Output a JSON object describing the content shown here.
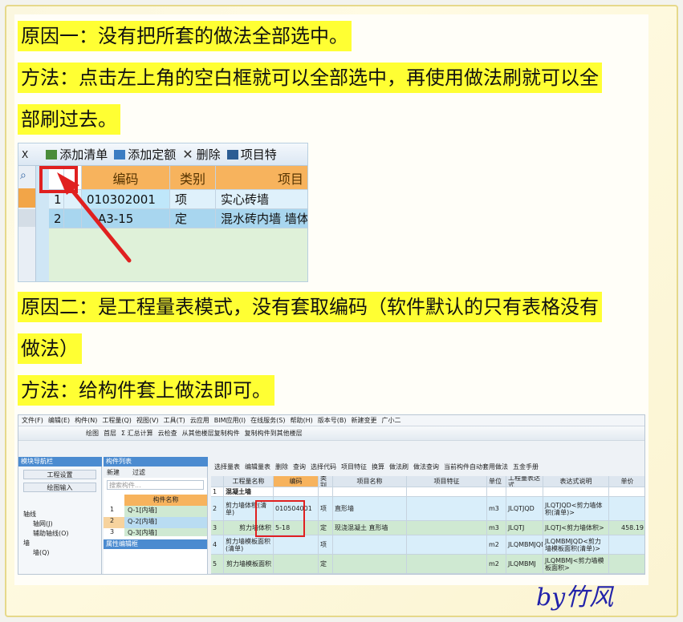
{
  "paragraphs": {
    "reason1": "原因一：没有把所套的做法全部选中。",
    "method1_line1": "方法：点击左上角的空白框就可以全部选中，再使用做法刷就可以全",
    "method1_line2": "部刷过去。",
    "reason2_line1": "原因二：是工程量表模式，没有套取编码（软件默认的只有表格没有",
    "reason2_line2": "做法）",
    "method2": "方法：给构件套上做法即可。"
  },
  "shot1": {
    "toolbar": {
      "close": "X",
      "add_list": "添加清单",
      "add_quota": "添加定额",
      "delete": "删除",
      "project": "项目特"
    },
    "headers": [
      "编码",
      "类别",
      "项目"
    ],
    "rows": [
      {
        "num": "1",
        "code": "010302001",
        "type": "项",
        "name": "实心砖墙"
      },
      {
        "num": "2",
        "code": "A3-15",
        "type": "定",
        "name": "混水砖内墙 墙体"
      }
    ]
  },
  "shot2": {
    "menu": [
      "文件(F)",
      "编辑(E)",
      "构件(N)",
      "工程量(Q)",
      "视图(V)",
      "工具(T)",
      "云应用",
      "BIM应用(I)",
      "在线服务(S)",
      "帮助(H)",
      "版本号(B)",
      "新建变更",
      "广小二"
    ],
    "toolbar2": [
      "绘图",
      "首层",
      "Σ 汇总计算",
      "云检查",
      "从其他楼层复制构件",
      "复制构件到其他楼层"
    ],
    "nav_title": "模块导航栏",
    "nav_items": [
      "工程设置",
      "绘图输入"
    ],
    "tree": [
      "轴线",
      "轴网(J)",
      "辅助轴线(O)",
      "墙",
      "墙(Q)"
    ],
    "component_title": "构件列表",
    "component_toolbar": [
      "新建",
      "过滤"
    ],
    "search_placeholder": "搜索构件...",
    "component_header": "构件名称",
    "components": [
      {
        "num": "1",
        "name": "Q-1[内墙]"
      },
      {
        "num": "2",
        "name": "Q-2[内墙]"
      },
      {
        "num": "3",
        "name": "Q-3[内墙]"
      }
    ],
    "property_title": "属性编辑框",
    "right_toolbar": [
      "选择量表",
      "编辑量表",
      "删除",
      "查询",
      "选择代码",
      "项目特征",
      "换算",
      "做法刷",
      "做法查询",
      "当前构件自动套用做法",
      "五金手册"
    ],
    "table_headers": [
      "",
      "工程量名称",
      "编码",
      "类别",
      "项目名称",
      "项目特征",
      "单位",
      "工程量表达式",
      "表达式说明",
      "单价"
    ],
    "table_rows": [
      {
        "num": "1",
        "name": "混凝土墙",
        "code": "",
        "type": "",
        "item": "",
        "feature": "",
        "unit": "",
        "expr": "",
        "desc": "",
        "price": ""
      },
      {
        "num": "2",
        "name": "剪力墙体积(清单)",
        "code": "010504001",
        "type": "项",
        "item": "直形墙",
        "feature": "",
        "unit": "m3",
        "expr": "JLQTJQD",
        "desc": "JLQTJQD<剪力墙体积(清单)>",
        "price": ""
      },
      {
        "num": "3",
        "name": "剪力墙体积",
        "code": "5-18",
        "type": "定",
        "item": "现浇混凝土 直形墙",
        "feature": "",
        "unit": "m3",
        "expr": "JLQTJ",
        "desc": "JLQTJ<剪力墙体积>",
        "price": "458.19"
      },
      {
        "num": "4",
        "name": "剪力墙模板面积(清单)",
        "code": "",
        "type": "项",
        "item": "",
        "feature": "",
        "unit": "m2",
        "expr": "JLQMBMJQD",
        "desc": "JLQMBMJQD<剪力墙模板面积(清单)>",
        "price": ""
      },
      {
        "num": "5",
        "name": "剪力墙模板面积",
        "code": "",
        "type": "定",
        "item": "",
        "feature": "",
        "unit": "m2",
        "expr": "JLQMBMJ",
        "desc": "JLQMBMJ<剪力墙模板面积>",
        "price": ""
      }
    ]
  },
  "signature": "by竹风",
  "colors": {
    "highlight": "#ffff33",
    "orange_header": "#f7b35d",
    "red_marker": "#e02020",
    "signature": "#2222aa"
  }
}
